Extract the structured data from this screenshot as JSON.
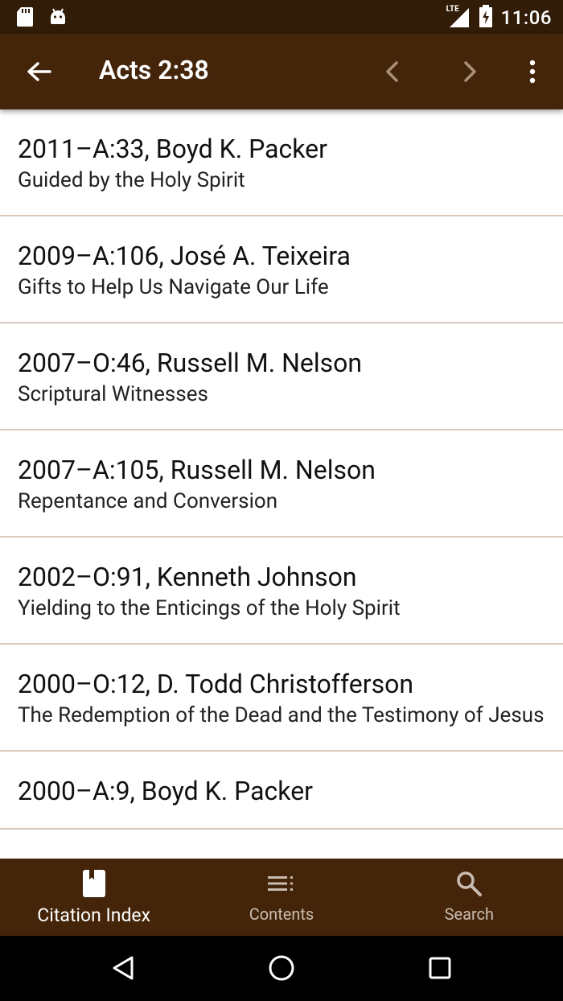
{
  "status_bar": {
    "network": "LTE",
    "time": "11:06"
  },
  "app_bar": {
    "title": "Acts 2:38"
  },
  "citations": [
    {
      "heading": "2011–A:33, Boyd K. Packer",
      "subtitle": "Guided by the Holy Spirit"
    },
    {
      "heading": "2009–A:106, José A. Teixeira",
      "subtitle": "Gifts to Help Us Navigate Our Life"
    },
    {
      "heading": "2007–O:46, Russell M. Nelson",
      "subtitle": "Scriptural Witnesses"
    },
    {
      "heading": "2007–A:105, Russell M. Nelson",
      "subtitle": "Repentance and Conversion"
    },
    {
      "heading": "2002–O:91, Kenneth Johnson",
      "subtitle": "Yielding to the Enticings of the Holy Spirit"
    },
    {
      "heading": "2000–O:12, D. Todd Christofferson",
      "subtitle": "The Redemption of the Dead and the Testimony of Jesus"
    },
    {
      "heading": "2000–A:9, Boyd K. Packer",
      "subtitle": ""
    }
  ],
  "bottom_nav": {
    "tabs": [
      {
        "label": "Citation Index",
        "icon": "bookmark-book-icon",
        "active": true
      },
      {
        "label": "Contents",
        "icon": "list-icon",
        "active": false
      },
      {
        "label": "Search",
        "icon": "search-icon",
        "active": false
      }
    ]
  },
  "colors": {
    "status_bar": "#311c07",
    "app_bar": "#442509",
    "divider": "#d9c8bb"
  }
}
